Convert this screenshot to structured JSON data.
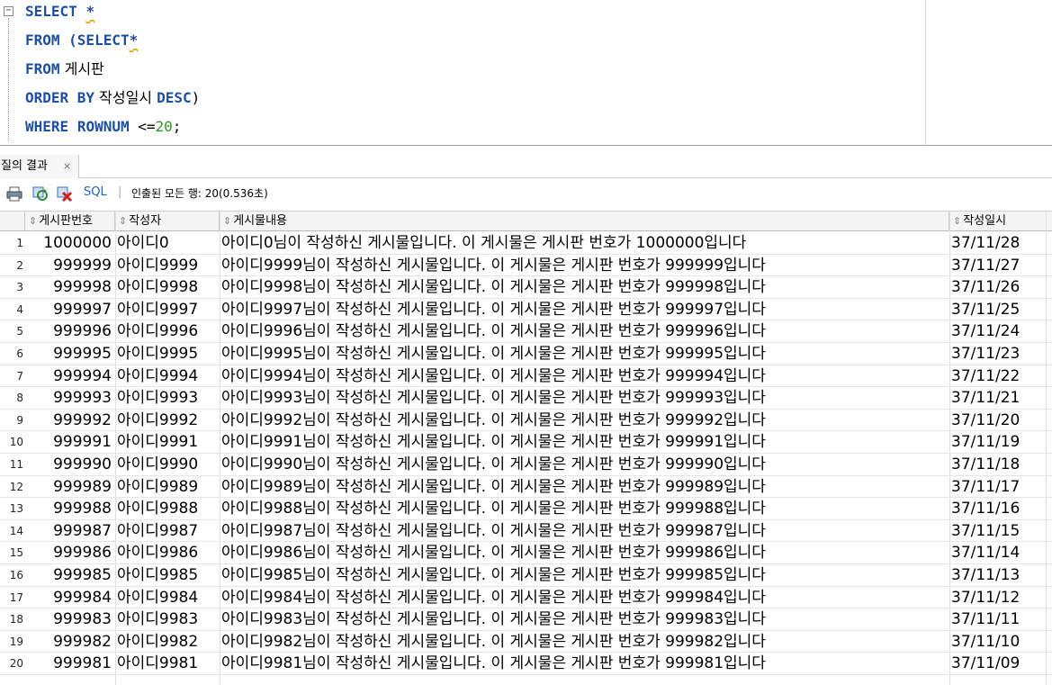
{
  "editor": {
    "lines": [
      {
        "parts": [
          {
            "t": "SELECT",
            "c": "kw"
          },
          {
            "t": " ",
            "c": ""
          },
          {
            "t": "*",
            "c": "kw warn"
          }
        ]
      },
      {
        "parts": [
          {
            "t": "FROM",
            "c": "kw"
          },
          {
            "t": " (",
            "c": "kw"
          },
          {
            "t": "SELECT",
            "c": "kw"
          },
          {
            "t": "*",
            "c": "kw warn"
          }
        ]
      },
      {
        "parts": [
          {
            "t": "FROM",
            "c": "kw"
          },
          {
            "t": " 게시판",
            "c": "txt"
          }
        ]
      },
      {
        "parts": [
          {
            "t": "ORDER BY",
            "c": "kw"
          },
          {
            "t": " 작성일시 ",
            "c": "txt"
          },
          {
            "t": "DESC",
            "c": "kw"
          },
          {
            "t": ")",
            "c": ""
          }
        ]
      },
      {
        "parts": [
          {
            "t": "WHERE",
            "c": "kw"
          },
          {
            "t": " ",
            "c": ""
          },
          {
            "t": "ROWNUM",
            "c": "kw"
          },
          {
            "t": " <=",
            "c": ""
          },
          {
            "t": "20",
            "c": "num"
          },
          {
            "t": ";",
            "c": ""
          }
        ]
      }
    ]
  },
  "results_tab": {
    "label": "질의 결과",
    "close": "×"
  },
  "toolbar": {
    "sql_label": "SQL",
    "separator": "|",
    "status": "인출된 모든 행: 20(0.536초)"
  },
  "columns": [
    "게시판번호",
    "작성자",
    "게시물내용",
    "작성일시"
  ],
  "rows": [
    [
      "1",
      "1000000",
      "아이디0",
      "아이디0님이 작성하신 게시물입니다. 이 게시물은 게시판 번호가 1000000입니다",
      "37/11/28"
    ],
    [
      "2",
      "999999",
      "아이디9999",
      "아이디9999님이 작성하신 게시물입니다. 이 게시물은 게시판 번호가 999999입니다",
      "37/11/27"
    ],
    [
      "3",
      "999998",
      "아이디9998",
      "아이디9998님이 작성하신 게시물입니다. 이 게시물은 게시판 번호가 999998입니다",
      "37/11/26"
    ],
    [
      "4",
      "999997",
      "아이디9997",
      "아이디9997님이 작성하신 게시물입니다. 이 게시물은 게시판 번호가 999997입니다",
      "37/11/25"
    ],
    [
      "5",
      "999996",
      "아이디9996",
      "아이디9996님이 작성하신 게시물입니다. 이 게시물은 게시판 번호가 999996입니다",
      "37/11/24"
    ],
    [
      "6",
      "999995",
      "아이디9995",
      "아이디9995님이 작성하신 게시물입니다. 이 게시물은 게시판 번호가 999995입니다",
      "37/11/23"
    ],
    [
      "7",
      "999994",
      "아이디9994",
      "아이디9994님이 작성하신 게시물입니다. 이 게시물은 게시판 번호가 999994입니다",
      "37/11/22"
    ],
    [
      "8",
      "999993",
      "아이디9993",
      "아이디9993님이 작성하신 게시물입니다. 이 게시물은 게시판 번호가 999993입니다",
      "37/11/21"
    ],
    [
      "9",
      "999992",
      "아이디9992",
      "아이디9992님이 작성하신 게시물입니다. 이 게시물은 게시판 번호가 999992입니다",
      "37/11/20"
    ],
    [
      "10",
      "999991",
      "아이디9991",
      "아이디9991님이 작성하신 게시물입니다. 이 게시물은 게시판 번호가 999991입니다",
      "37/11/19"
    ],
    [
      "11",
      "999990",
      "아이디9990",
      "아이디9990님이 작성하신 게시물입니다. 이 게시물은 게시판 번호가 999990입니다",
      "37/11/18"
    ],
    [
      "12",
      "999989",
      "아이디9989",
      "아이디9989님이 작성하신 게시물입니다. 이 게시물은 게시판 번호가 999989입니다",
      "37/11/17"
    ],
    [
      "13",
      "999988",
      "아이디9988",
      "아이디9988님이 작성하신 게시물입니다. 이 게시물은 게시판 번호가 999988입니다",
      "37/11/16"
    ],
    [
      "14",
      "999987",
      "아이디9987",
      "아이디9987님이 작성하신 게시물입니다. 이 게시물은 게시판 번호가 999987입니다",
      "37/11/15"
    ],
    [
      "15",
      "999986",
      "아이디9986",
      "아이디9986님이 작성하신 게시물입니다. 이 게시물은 게시판 번호가 999986입니다",
      "37/11/14"
    ],
    [
      "16",
      "999985",
      "아이디9985",
      "아이디9985님이 작성하신 게시물입니다. 이 게시물은 게시판 번호가 999985입니다",
      "37/11/13"
    ],
    [
      "17",
      "999984",
      "아이디9984",
      "아이디9984님이 작성하신 게시물입니다. 이 게시물은 게시판 번호가 999984입니다",
      "37/11/12"
    ],
    [
      "18",
      "999983",
      "아이디9983",
      "아이디9983님이 작성하신 게시물입니다. 이 게시물은 게시판 번호가 999983입니다",
      "37/11/11"
    ],
    [
      "19",
      "999982",
      "아이디9982",
      "아이디9982님이 작성하신 게시물입니다. 이 게시물은 게시판 번호가 999982입니다",
      "37/11/10"
    ],
    [
      "20",
      "999981",
      "아이디9981",
      "아이디9981님이 작성하신 게시물입니다. 이 게시물은 게시판 번호가 999981입니다",
      "37/11/09"
    ]
  ],
  "icons": {
    "toolbar": [
      "print-icon",
      "refresh-icon",
      "delete-icon"
    ],
    "sort": "sort-arrows-icon",
    "fold": "fold-collapse-icon"
  },
  "colors": {
    "keyword": "#1f4fa0",
    "number": "#2a9a2a",
    "sql_link": "#1f63c8"
  }
}
